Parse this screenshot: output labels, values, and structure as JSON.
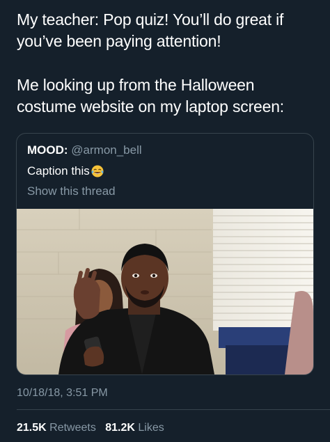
{
  "tweet": {
    "line1": "My teacher: Pop quiz! You’ll do great if you’ve been paying attention!",
    "line2": "Me looking up from the Halloween costume website on my laptop screen:"
  },
  "quote": {
    "name": "MOOD:",
    "handle": "@armon_bell",
    "text": "Caption this",
    "emoji": "face-with-tears-of-joy-icon",
    "show_thread": "Show this thread"
  },
  "meta": {
    "timestamp": "10/18/18, 3:51 PM",
    "retweets_count": "21.5K",
    "retweets_label": "Retweets",
    "likes_count": "81.2K",
    "likes_label": "Likes"
  },
  "colors": {
    "background": "#15202b",
    "text": "#ffffff",
    "secondary": "#8899a6",
    "border": "#38444d"
  }
}
